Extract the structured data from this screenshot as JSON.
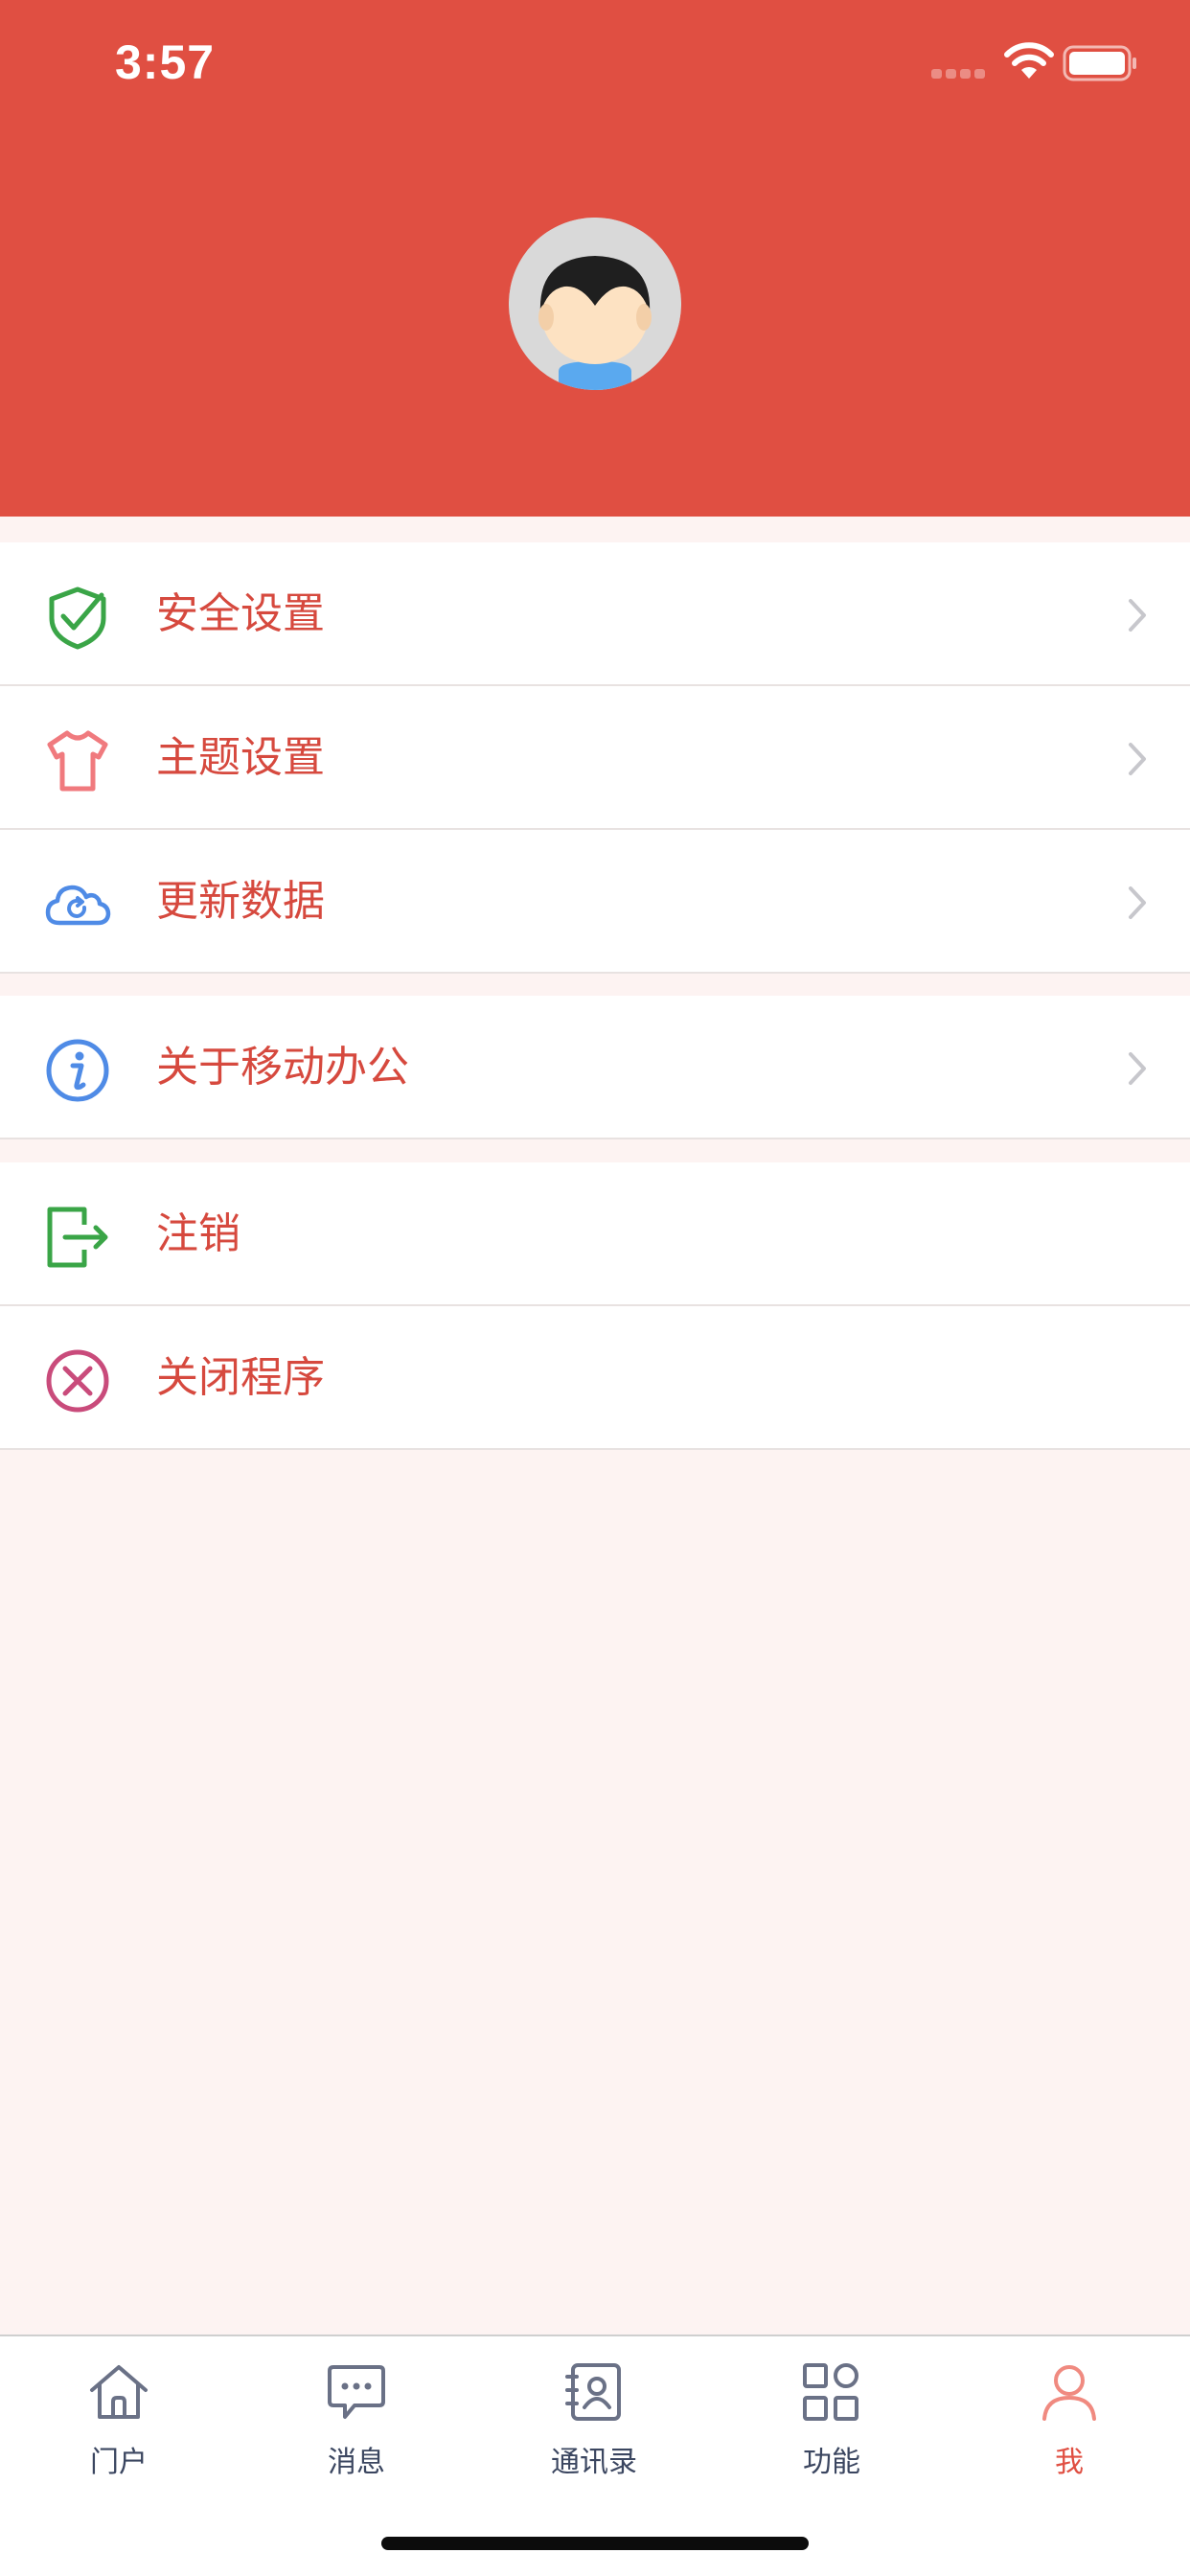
{
  "status_bar": {
    "time": "3:57"
  },
  "profile": {
    "avatar_icon": "user-avatar"
  },
  "menu": {
    "groups": [
      {
        "items": [
          {
            "label": "安全设置",
            "icon": "shield-check-icon",
            "color": "#3aa547"
          },
          {
            "label": "主题设置",
            "icon": "shirt-icon",
            "color": "#f07a7e"
          },
          {
            "label": "更新数据",
            "icon": "cloud-refresh-icon",
            "color": "#4f8be6"
          }
        ]
      },
      {
        "items": [
          {
            "label": "关于移动办公",
            "icon": "info-icon",
            "color": "#4f8be6"
          }
        ]
      },
      {
        "items": [
          {
            "label": "注销",
            "icon": "logout-icon",
            "color": "#3aa547"
          },
          {
            "label": "关闭程序",
            "icon": "close-circle-icon",
            "color": "#c94b7b"
          }
        ]
      }
    ]
  },
  "tabbar": {
    "tabs": [
      {
        "label": "门户",
        "icon": "home-icon"
      },
      {
        "label": "消息",
        "icon": "chat-icon"
      },
      {
        "label": "通讯录",
        "icon": "contacts-icon"
      },
      {
        "label": "功能",
        "icon": "apps-icon"
      },
      {
        "label": "我",
        "icon": "person-icon",
        "active": true
      }
    ]
  },
  "colors": {
    "header": "#e04f42",
    "label": "#d6493e",
    "background": "#fdf3f2",
    "tab_active": "#e04f42",
    "tab_inactive": "#3b4660"
  }
}
